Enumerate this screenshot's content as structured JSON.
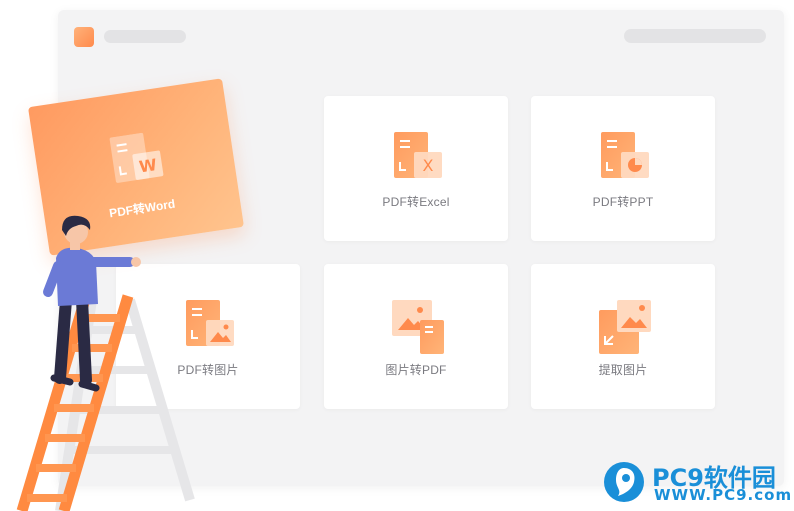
{
  "cards": {
    "pdf_to_word": {
      "label": "PDF转Word",
      "glyph": "W"
    },
    "pdf_to_excel": {
      "label": "PDF转Excel",
      "glyph": "X"
    },
    "pdf_to_ppt": {
      "label": "PDF转PPT"
    },
    "pdf_to_image": {
      "label": "PDF转图片"
    },
    "image_to_pdf": {
      "label": "图片转PDF"
    },
    "extract_images": {
      "label": "提取图片"
    }
  },
  "watermark": {
    "name": "PC9软件园",
    "url": "WWW.PC9.com"
  },
  "colors": {
    "accent": "#ff8a4c",
    "accent_light": "#ffc48e",
    "brand_blue": "#1a8fd8"
  }
}
